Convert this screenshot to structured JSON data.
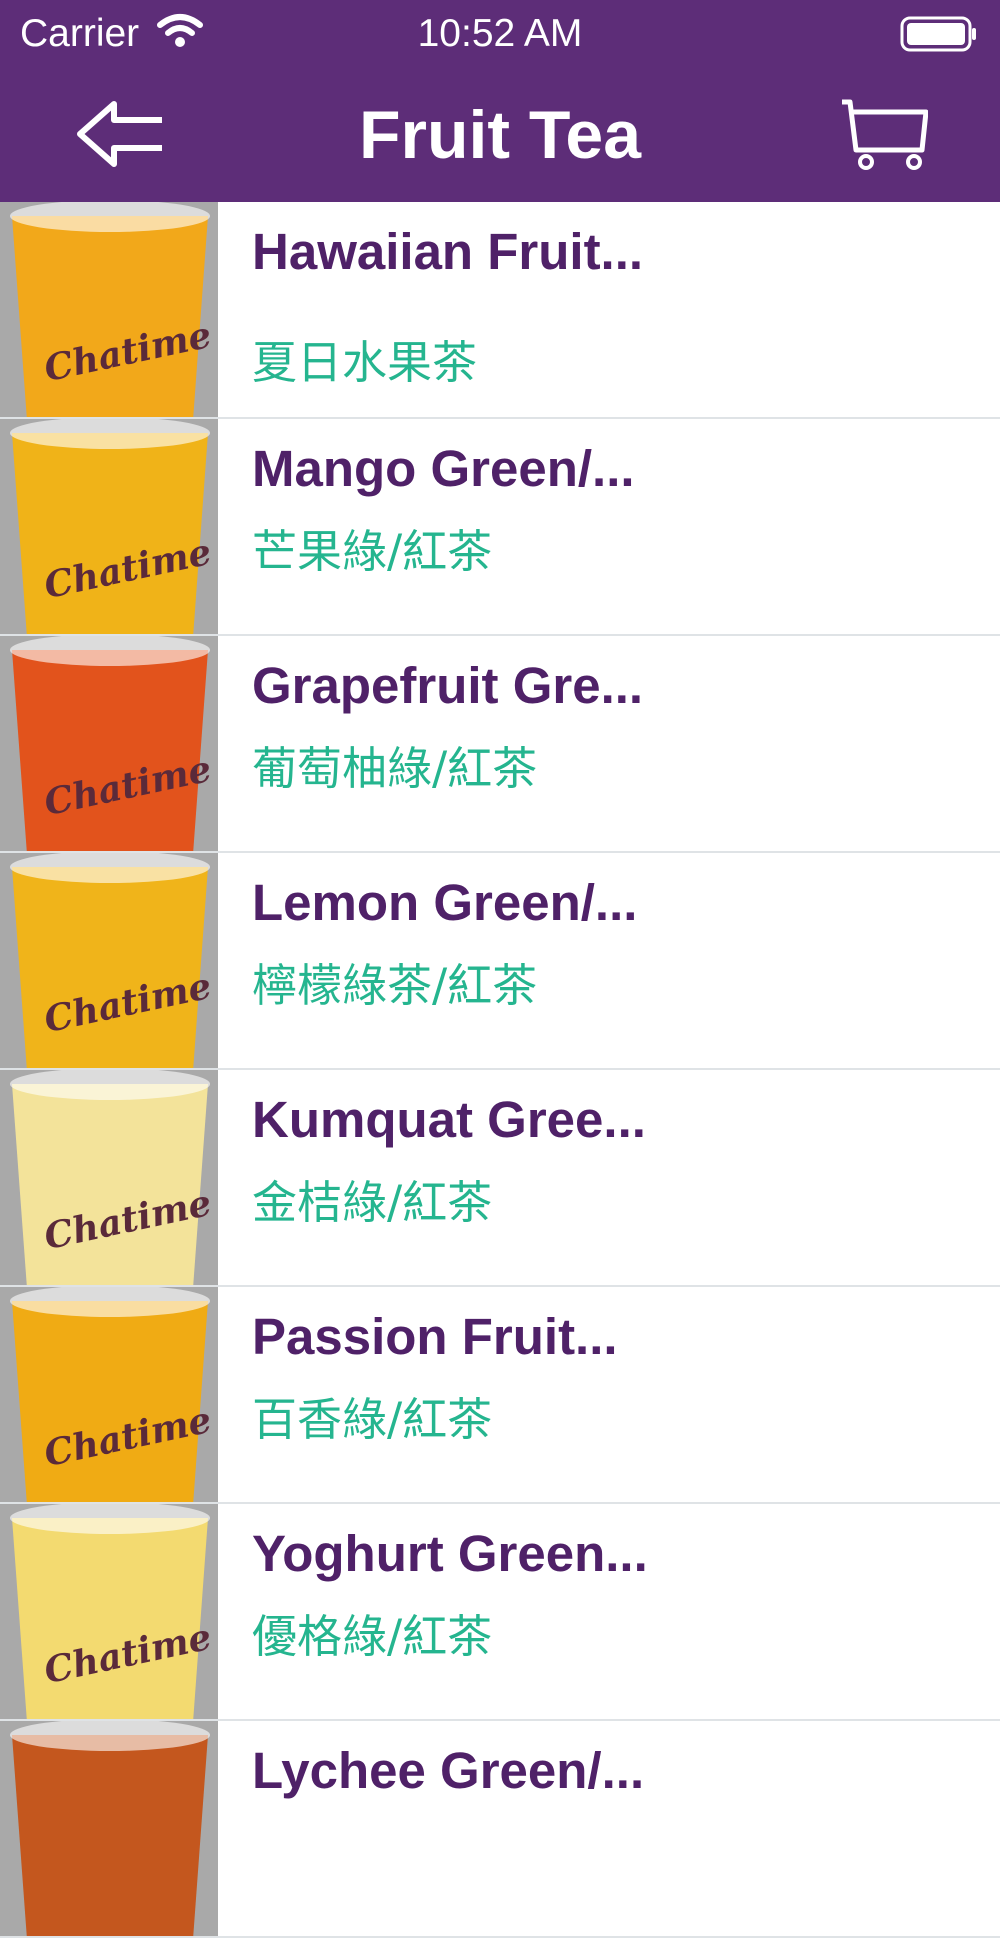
{
  "status_bar": {
    "carrier": "Carrier",
    "time": "10:52 AM"
  },
  "nav": {
    "title": "Fruit Tea",
    "back_icon": "back-arrow-icon",
    "cart_icon": "cart-icon"
  },
  "colors": {
    "header": "#5d2d78",
    "name_text": "#4f2168",
    "sub_text": "#25b58f"
  },
  "items": [
    {
      "name": "Hawaiian Fruit...",
      "subtitle": "夏日水果茶",
      "cup_color": "#f2a81a"
    },
    {
      "name": "Mango Green/...",
      "subtitle": "芒果綠/紅茶",
      "cup_color": "#f0b318"
    },
    {
      "name": "Grapefruit Gre...",
      "subtitle": "葡萄柚綠/紅茶",
      "cup_color": "#e2531c"
    },
    {
      "name": "Lemon Green/...",
      "subtitle": "檸檬綠茶/紅茶",
      "cup_color": "#f0b41a"
    },
    {
      "name": "Kumquat Gree...",
      "subtitle": "金桔綠/紅茶",
      "cup_color": "#f3e39a"
    },
    {
      "name": "Passion Fruit...",
      "subtitle": "百香綠/紅茶",
      "cup_color": "#f0ab14"
    },
    {
      "name": "Yoghurt Green...",
      "subtitle": "優格綠/紅茶",
      "cup_color": "#f3da70"
    },
    {
      "name": "Lychee Green/...",
      "subtitle": "",
      "cup_color": "#c4571e"
    }
  ]
}
